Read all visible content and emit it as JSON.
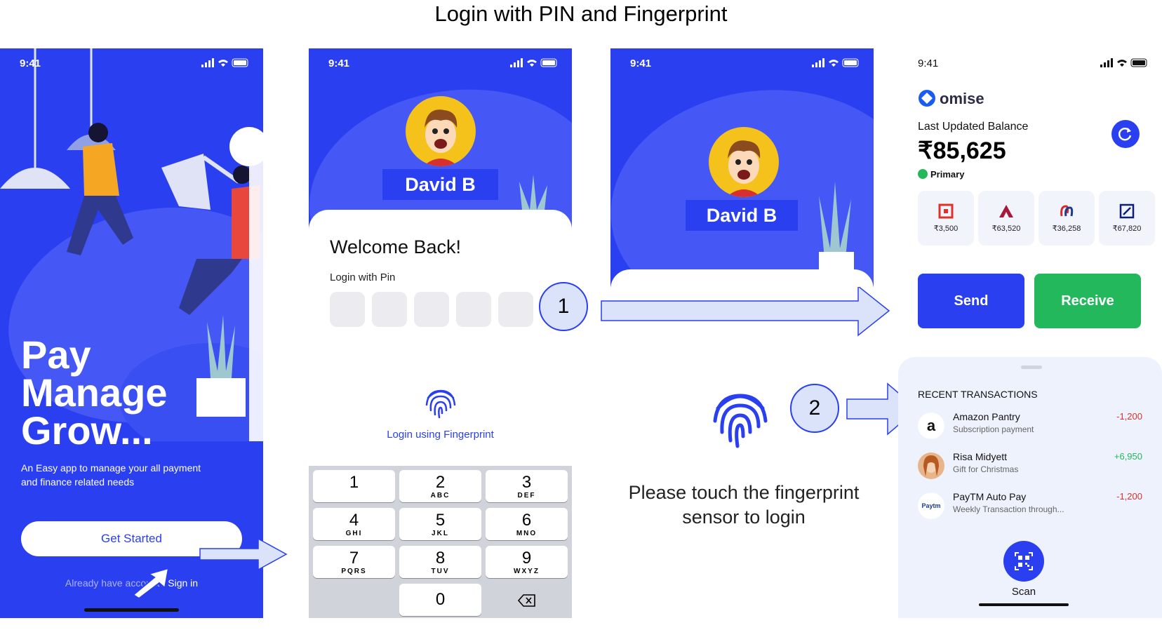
{
  "title": "Login with PIN and Fingerprint",
  "colors": {
    "brand_blue": "#2a3ff0",
    "blob_blue": "#4557f4",
    "receive_green": "#23b85c",
    "arrow_fill": "#dbe3fb",
    "debit_red": "#e0302a",
    "credit_green": "#23b85c"
  },
  "screen1": {
    "time": "9:41",
    "headline": [
      "Pay",
      "Manage",
      "Grow..."
    ],
    "subtitle": "An Easy app to manage your all payment and finance related needs",
    "cta_label": "Get Started",
    "signin_prompt": "Already have account?",
    "signin_link": "Sign in"
  },
  "screen2": {
    "time": "9:41",
    "user_name": "David B",
    "welcome": "Welcome Back!",
    "pin_label": "Login with Pin",
    "pin_boxes": [
      "",
      "",
      "",
      "",
      ""
    ],
    "fingerprint_label": "Login using Fingerprint",
    "keypad": [
      {
        "num": "1",
        "letters": ""
      },
      {
        "num": "2",
        "letters": "ABC"
      },
      {
        "num": "3",
        "letters": "DEF"
      },
      {
        "num": "4",
        "letters": "GHI"
      },
      {
        "num": "5",
        "letters": "JKL"
      },
      {
        "num": "6",
        "letters": "MNO"
      },
      {
        "num": "7",
        "letters": "PQRS"
      },
      {
        "num": "8",
        "letters": "TUV"
      },
      {
        "num": "9",
        "letters": "WXYZ"
      },
      {
        "num": "0",
        "letters": ""
      }
    ],
    "delete_icon": "backspace-icon"
  },
  "screen3": {
    "time": "9:41",
    "user_name": "David B",
    "touch_message": "Please touch the fingerprint sensor to login"
  },
  "steps": {
    "step1": "1",
    "step2": "2"
  },
  "screen4": {
    "time": "9:41",
    "brand": "omise",
    "balance_label": "Last Updated Balance",
    "balance": "₹85,625",
    "account_type": "Primary",
    "banks": [
      {
        "icon": "hdfc-bank-icon",
        "amount": "₹3,500",
        "color": "#e0302a"
      },
      {
        "icon": "axis-bank-icon",
        "amount": "₹63,520",
        "color": "#a6193c"
      },
      {
        "icon": "union-bank-icon",
        "amount": "₹36,258",
        "color": "#d62a2a"
      },
      {
        "icon": "deutsche-bank-icon",
        "amount": "₹67,820",
        "color": "#0a1e7a"
      }
    ],
    "send_label": "Send",
    "receive_label": "Receive",
    "transactions_header": "RECENT TRANSACTIONS",
    "transactions": [
      {
        "icon": "amazon-icon",
        "glyph": "a",
        "name": "Amazon Pantry",
        "detail": "Subscription payment",
        "amount": "-1,200",
        "type": "debit"
      },
      {
        "icon": "person-avatar",
        "glyph": "",
        "name": "Risa Midyett",
        "detail": "Gift for Christmas",
        "amount": "+6,950",
        "type": "credit"
      },
      {
        "icon": "paytm-icon",
        "glyph": "Paytm",
        "name": "PayTM Auto Pay",
        "detail": "Weekly Transaction through...",
        "amount": "-1,200",
        "type": "debit"
      }
    ],
    "scan_label": "Scan"
  }
}
